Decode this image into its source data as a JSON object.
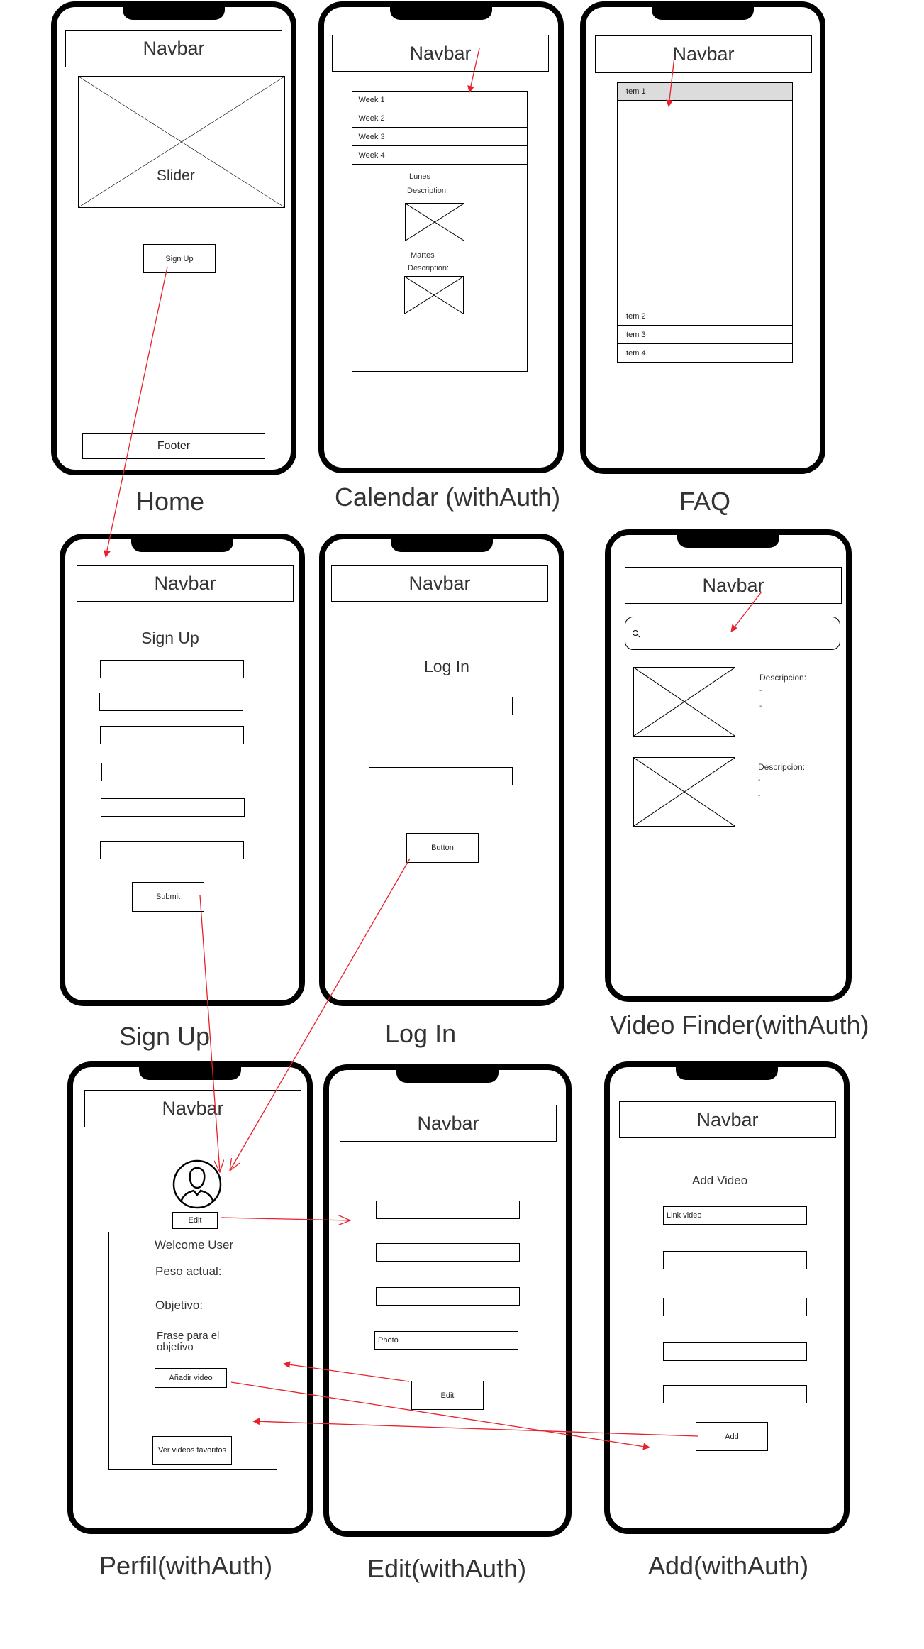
{
  "screens": {
    "home": {
      "label": "Home",
      "navbar": "Navbar",
      "slider": "Slider",
      "signup_button": "Sign Up",
      "footer": "Footer"
    },
    "calendar": {
      "label": "Calendar (withAuth)",
      "navbar": "Navbar",
      "weeks": [
        "Week 1",
        "Week 2",
        "Week 3",
        "Week 4"
      ],
      "day1": "Lunes",
      "day1_desc": "Description:",
      "day2": "Martes",
      "day2_desc": "Description:"
    },
    "faq": {
      "label": "FAQ",
      "navbar": "Navbar",
      "items": [
        "Item 1",
        "Item 2",
        "Item 3",
        "Item 4"
      ]
    },
    "signup": {
      "label": "Sign Up",
      "navbar": "Navbar",
      "title": "Sign Up",
      "submit": "Submit"
    },
    "login": {
      "label": "Log In",
      "navbar": "Navbar",
      "title": "Log In",
      "button": "Button"
    },
    "video_finder": {
      "label": "Video Finder(withAuth)",
      "navbar": "Navbar",
      "desc1": "Descripcion:",
      "desc2": "Descripcion:",
      "bullet": "-"
    },
    "perfil": {
      "label": "Perfil(withAuth)",
      "navbar": "Navbar",
      "edit": "Edit",
      "welcome": "Welcome User",
      "peso": "Peso actual:",
      "objetivo": "Objetivo:",
      "frase_line1": "Frase para el",
      "frase_line2": "objetivo",
      "add_video": "Añadir video",
      "fav_videos": "Ver videos favoritos"
    },
    "edit": {
      "label": "Edit(withAuth)",
      "navbar": "Navbar",
      "photo": "Photo",
      "edit_button": "Edit"
    },
    "add": {
      "label": "Add(withAuth)",
      "navbar": "Navbar",
      "title": "Add Video",
      "link_video": "Link video",
      "add_button": "Add"
    }
  },
  "colors": {
    "arrow": "#e8212b",
    "stroke": "#000000"
  }
}
